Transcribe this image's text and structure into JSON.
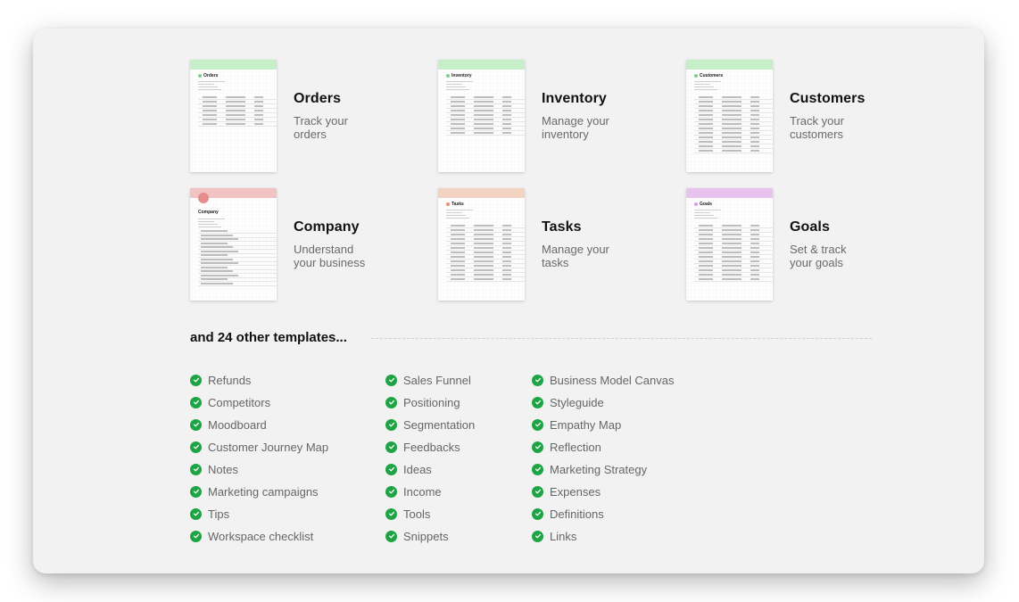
{
  "templates": [
    {
      "title": "Orders",
      "desc_line1": "Track your",
      "desc_line2": "orders",
      "thumb_title": "Orders",
      "band_color": "#c6efc9",
      "icon_color": "#7fd08a"
    },
    {
      "title": "Inventory",
      "desc_line1": "Manage your",
      "desc_line2": "inventory",
      "thumb_title": "Inventory",
      "band_color": "#c6efc9",
      "icon_color": "#7fd08a"
    },
    {
      "title": "Customers",
      "desc_line1": "Track your",
      "desc_line2": "customers",
      "thumb_title": "Customers",
      "band_color": "#c6efc9",
      "icon_color": "#7fd08a"
    },
    {
      "title": "Company",
      "desc_line1": "Understand",
      "desc_line2": "your business",
      "thumb_title": "Company",
      "band_color": "#f2c3c3",
      "icon_color": "#e58c8c"
    },
    {
      "title": "Tasks",
      "desc_line1": "Manage your",
      "desc_line2": "tasks",
      "thumb_title": "Tasks",
      "band_color": "#f3d3c2",
      "icon_color": "#ef8f7a"
    },
    {
      "title": "Goals",
      "desc_line1": "Set & track",
      "desc_line2": "your goals",
      "thumb_title": "Goals",
      "band_color": "#e8c3ef",
      "icon_color": "#d89be3"
    }
  ],
  "others_heading": "and 24 other templates...",
  "check_color": "#1fa445",
  "other_templates": {
    "col1": [
      "Refunds",
      "Competitors",
      "Moodboard",
      "Customer Journey Map",
      "Notes",
      "Marketing campaigns",
      "Tips",
      "Workspace checklist"
    ],
    "col2": [
      "Sales Funnel",
      "Positioning",
      "Segmentation",
      "Feedbacks",
      "Ideas",
      "Income",
      "Tools",
      "Snippets"
    ],
    "col3": [
      "Business Model Canvas",
      "Styleguide",
      "Empathy Map",
      "Reflection",
      "Marketing Strategy",
      "Expenses",
      "Definitions",
      "Links"
    ]
  }
}
